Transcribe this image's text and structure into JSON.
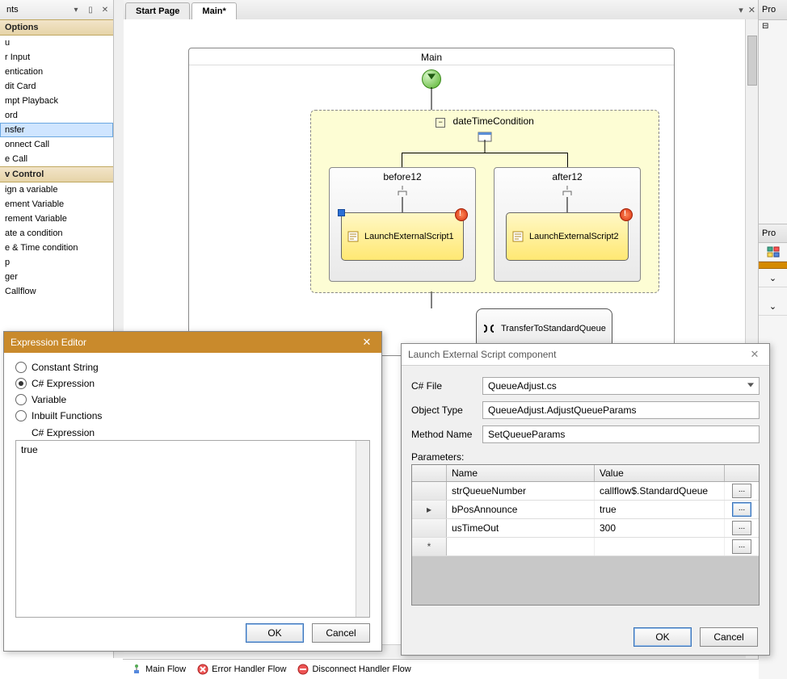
{
  "left_panel": {
    "header": "nts",
    "group_options": "Options",
    "items_a": [
      "u",
      "r Input",
      "entication",
      "dit Card",
      "mpt Playback",
      "ord",
      "nsfer",
      "onnect Call",
      "e Call"
    ],
    "selected_index_a": 6,
    "group_control": "v Control",
    "items_b": [
      "ign a variable",
      "ement Variable",
      "rement Variable",
      "ate a condition",
      "e & Time condition",
      "p",
      "ger",
      "Callflow"
    ]
  },
  "center": {
    "tabs": {
      "start": "Start Page",
      "main": "Main*"
    },
    "diagram": {
      "main_title": "Main",
      "cond_title": "dateTimeCondition",
      "branch_left": "before12",
      "branch_right": "after12",
      "script1": "LaunchExternalScript1",
      "script2": "LaunchExternalScript2",
      "transfer": "TransferToStandardQueue"
    }
  },
  "flow_tabs": {
    "main": "Main Flow",
    "error": "Error Handler Flow",
    "disconnect": "Disconnect Handler Flow"
  },
  "right_strip": {
    "top": "Pro",
    "mid": "Pro"
  },
  "expr_dlg": {
    "title": "Expression Editor",
    "opts": {
      "const": "Constant String",
      "csharp": "C# Expression",
      "var": "Variable",
      "inbuilt": "Inbuilt Functions"
    },
    "label": "C# Expression",
    "value": "true",
    "ok": "OK",
    "cancel": "Cancel"
  },
  "les_dlg": {
    "title": "Launch External Script component",
    "labels": {
      "file": "C# File",
      "object": "Object Type",
      "method": "Method Name",
      "params": "Parameters:"
    },
    "values": {
      "file": "QueueAdjust.cs",
      "object": "QueueAdjust.AdjustQueueParams",
      "method": "SetQueueParams"
    },
    "grid": {
      "head_name": "Name",
      "head_value": "Value",
      "rows": [
        {
          "name": "strQueueNumber",
          "value": "callflow$.StandardQueue"
        },
        {
          "name": "bPosAnnounce",
          "value": "true"
        },
        {
          "name": "usTimeOut",
          "value": "300"
        }
      ],
      "active_row": 1
    },
    "ok": "OK",
    "cancel": "Cancel"
  }
}
